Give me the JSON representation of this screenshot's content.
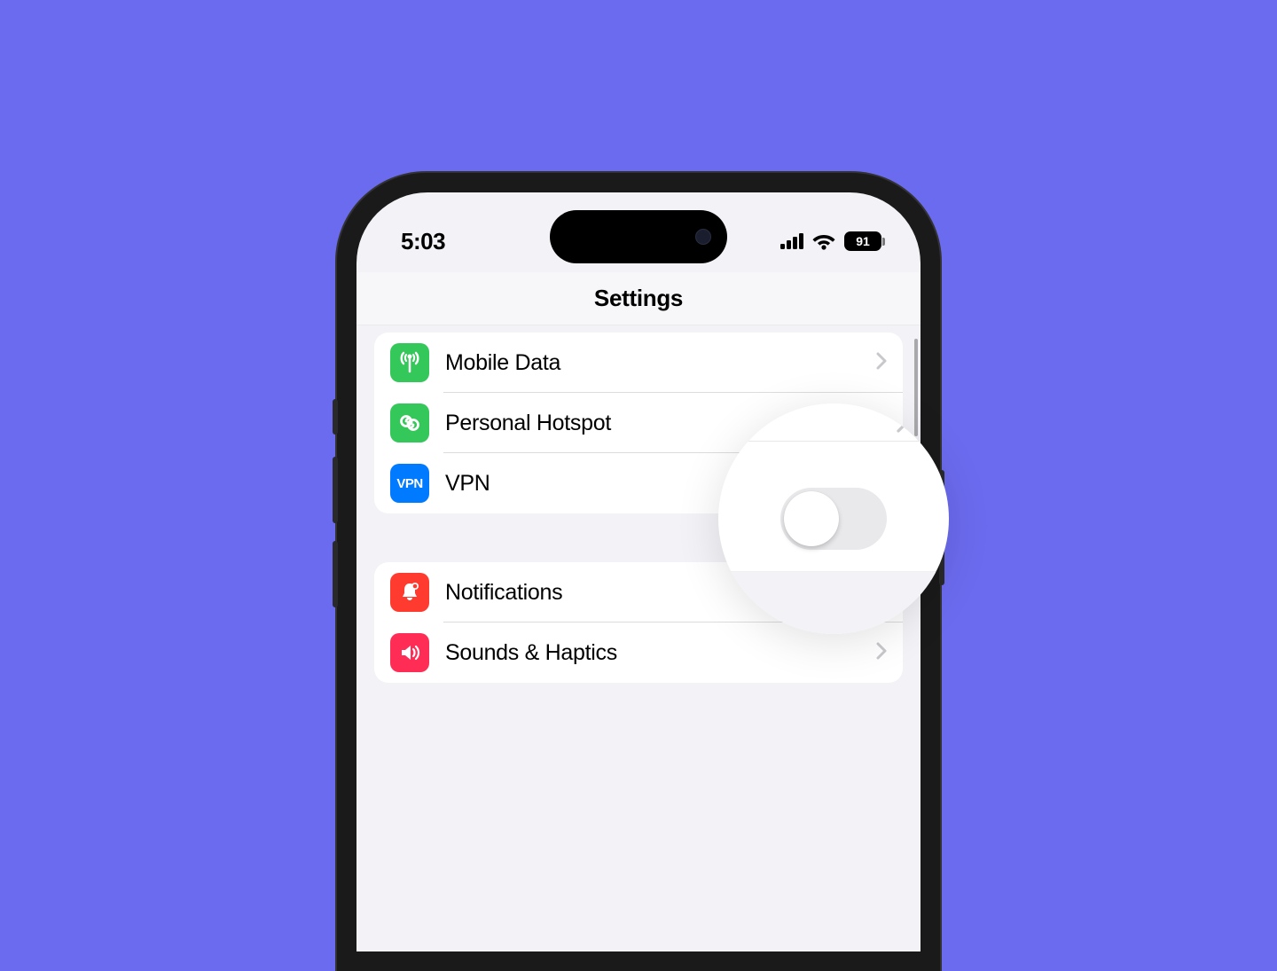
{
  "status": {
    "time": "5:03",
    "battery": "91"
  },
  "nav": {
    "title": "Settings"
  },
  "group1": {
    "rows": [
      {
        "label": "Mobile Data",
        "icon": "antenna"
      },
      {
        "label": "Personal Hotspot",
        "icon": "link"
      },
      {
        "label": "VPN",
        "icon": "vpn",
        "vpn_text": "VPN"
      }
    ]
  },
  "group2": {
    "rows": [
      {
        "label": "Notifications",
        "icon": "bell"
      },
      {
        "label": "Sounds & Haptics",
        "icon": "speaker"
      }
    ]
  },
  "vpn_toggle_state": "off"
}
